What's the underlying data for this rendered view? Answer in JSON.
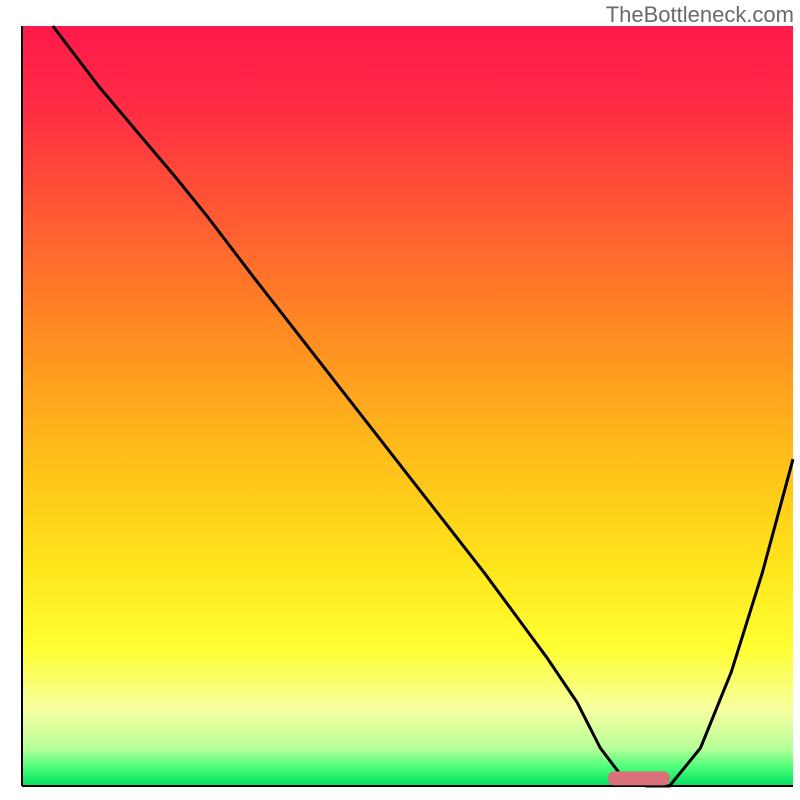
{
  "watermark": "TheBottleneck.com",
  "chart_data": {
    "type": "line",
    "title": "",
    "xlabel": "",
    "ylabel": "",
    "xlim": [
      0,
      100
    ],
    "ylim": [
      0,
      100
    ],
    "x": [
      0,
      4,
      10,
      20,
      24,
      30,
      40,
      50,
      60,
      68,
      72,
      75,
      78,
      81,
      84,
      88,
      92,
      96,
      100
    ],
    "values": [
      null,
      100,
      92,
      80,
      75,
      67,
      54,
      41,
      28,
      17,
      11,
      5,
      1,
      0,
      0,
      5,
      15,
      28,
      43
    ],
    "marker": {
      "x_start": 76,
      "x_end": 84,
      "y": 1
    },
    "gradient_stops": [
      {
        "offset": 0.0,
        "color": "#ff1a4b"
      },
      {
        "offset": 0.1,
        "color": "#ff2a44"
      },
      {
        "offset": 0.25,
        "color": "#ff5a33"
      },
      {
        "offset": 0.4,
        "color": "#ff8a22"
      },
      {
        "offset": 0.55,
        "color": "#ffb91a"
      },
      {
        "offset": 0.7,
        "color": "#ffe21a"
      },
      {
        "offset": 0.82,
        "color": "#ffff33"
      },
      {
        "offset": 0.9,
        "color": "#f6ffa0"
      },
      {
        "offset": 0.95,
        "color": "#b8ff9a"
      },
      {
        "offset": 0.975,
        "color": "#4dff7a"
      },
      {
        "offset": 1.0,
        "color": "#00e060"
      }
    ],
    "marker_color": "#d9707a",
    "curve_color": "#000000"
  }
}
